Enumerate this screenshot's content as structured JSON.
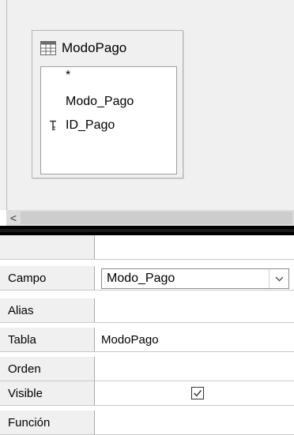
{
  "table_window": {
    "title": "ModoPago",
    "icon": "table-icon",
    "fields": [
      {
        "label": "*",
        "key": false
      },
      {
        "label": "Modo_Pago",
        "key": false
      },
      {
        "label": "ID_Pago",
        "key": true
      }
    ]
  },
  "scrollbar": {
    "left_arrow": "<"
  },
  "grid": {
    "rows": [
      {
        "label": "",
        "value": ""
      },
      {
        "label": "Campo",
        "value": "Modo_Pago",
        "type": "combo"
      },
      {
        "label": "Alias",
        "value": ""
      },
      {
        "label": "Tabla",
        "value": "ModoPago"
      },
      {
        "label": "Orden",
        "value": ""
      },
      {
        "label": "Visible",
        "value": "",
        "type": "checkbox",
        "checked": true
      },
      {
        "label": "Función",
        "value": ""
      }
    ]
  }
}
